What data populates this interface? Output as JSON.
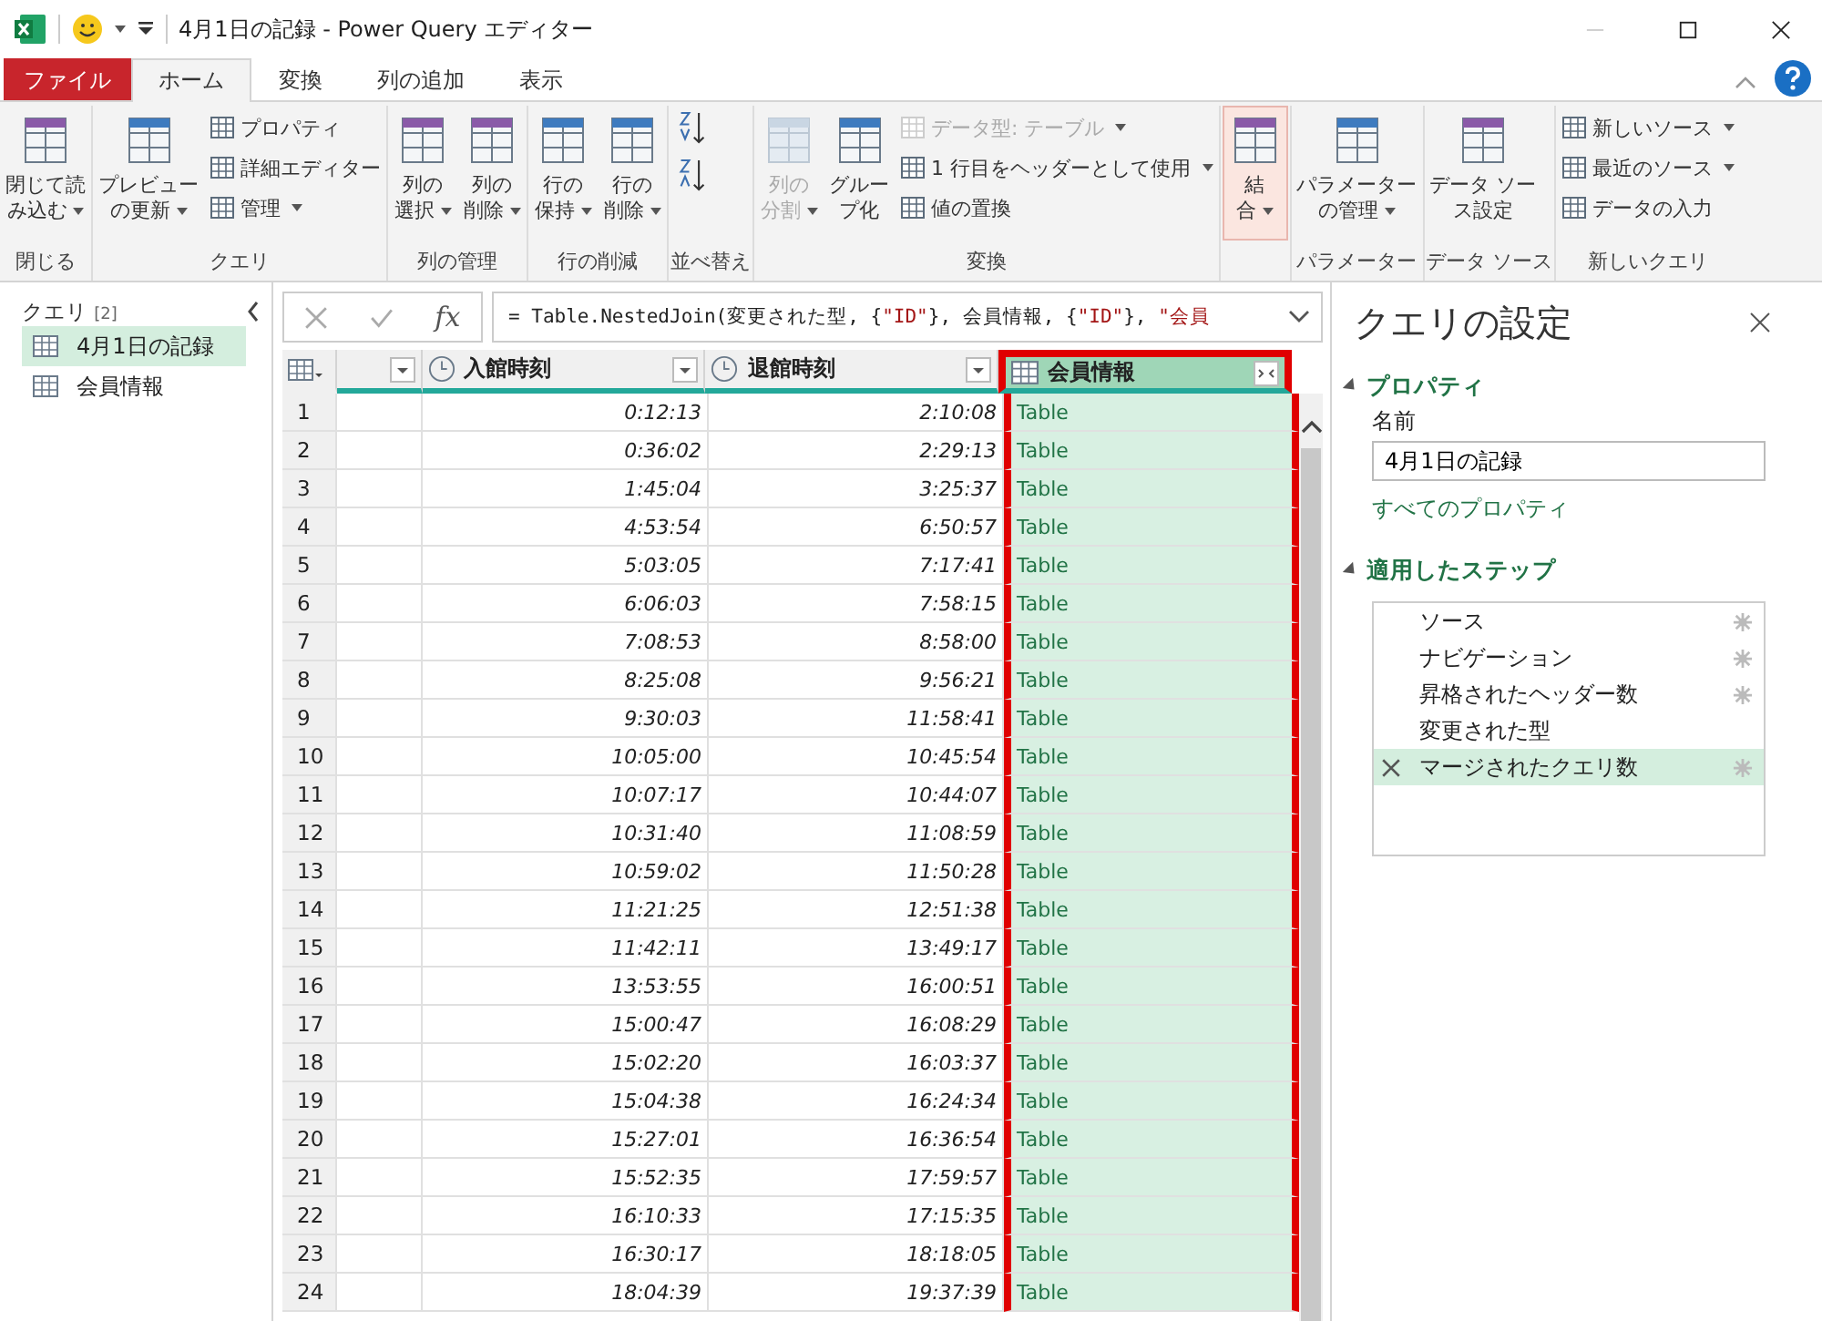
{
  "window": {
    "title": "4月1日の記録 - Power Query エディター"
  },
  "tabs": [
    {
      "label": "ファイル",
      "kind": "file",
      "selected": false
    },
    {
      "label": "ホーム",
      "kind": "tab",
      "selected": true
    },
    {
      "label": "変換",
      "kind": "tab",
      "selected": false
    },
    {
      "label": "列の追加",
      "kind": "tab",
      "selected": false
    },
    {
      "label": "表示",
      "kind": "tab",
      "selected": false
    }
  ],
  "ribbon": [
    {
      "label": "閉じる",
      "items": [
        {
          "kind": "large",
          "lines": [
            "閉じて読",
            "み込む"
          ],
          "dropdown": true,
          "disabled": false
        }
      ]
    },
    {
      "label": "クエリ",
      "items": [
        {
          "kind": "large",
          "lines": [
            "プレビュー",
            "の更新"
          ],
          "dropdown": true,
          "disabled": false
        },
        {
          "kind": "stack",
          "entries": [
            {
              "label": "プロパティ",
              "dropdown": false,
              "disabled": false
            },
            {
              "label": "詳細エディター",
              "dropdown": false,
              "disabled": false
            },
            {
              "label": "管理",
              "dropdown": true,
              "disabled": false
            }
          ]
        }
      ]
    },
    {
      "label": "列の管理",
      "items": [
        {
          "kind": "large",
          "lines": [
            "列の",
            "選択"
          ],
          "dropdown": true,
          "disabled": false
        },
        {
          "kind": "large",
          "lines": [
            "列の",
            "削除"
          ],
          "dropdown": true,
          "disabled": false
        }
      ]
    },
    {
      "label": "行の削減",
      "items": [
        {
          "kind": "large",
          "lines": [
            "行の",
            "保持"
          ],
          "dropdown": true,
          "disabled": false
        },
        {
          "kind": "large",
          "lines": [
            "行の",
            "削除"
          ],
          "dropdown": true,
          "disabled": false
        }
      ]
    },
    {
      "label": "並べ替え",
      "items": [
        {
          "kind": "sort"
        }
      ]
    },
    {
      "label": "変換",
      "items": [
        {
          "kind": "large",
          "lines": [
            "列の",
            "分割"
          ],
          "dropdown": true,
          "disabled": true
        },
        {
          "kind": "large",
          "lines": [
            "グルー",
            "プ化"
          ],
          "dropdown": false,
          "disabled": false
        },
        {
          "kind": "stack",
          "entries": [
            {
              "label": "データ型: テーブル",
              "dropdown": true,
              "disabled": true
            },
            {
              "label": "1 行目をヘッダーとして使用",
              "dropdown": true,
              "disabled": false
            },
            {
              "label": "値の置換",
              "dropdown": false,
              "disabled": false
            }
          ]
        }
      ]
    },
    {
      "items": [
        {
          "kind": "large",
          "lines": [
            "結",
            "合"
          ],
          "dropdown": true,
          "disabled": false,
          "selected": true
        }
      ]
    },
    {
      "label": "パラメーター",
      "items": [
        {
          "kind": "large",
          "lines": [
            "パラメーター",
            "の管理"
          ],
          "dropdown": true,
          "disabled": false
        }
      ]
    },
    {
      "label": "データ ソース",
      "items": [
        {
          "kind": "large",
          "lines": [
            "データ ソー",
            "ス設定"
          ],
          "dropdown": false,
          "disabled": false
        }
      ]
    },
    {
      "label": "新しいクエリ",
      "items": [
        {
          "kind": "stack",
          "entries": [
            {
              "label": "新しいソース",
              "dropdown": true,
              "disabled": false
            },
            {
              "label": "最近のソース",
              "dropdown": true,
              "disabled": false
            },
            {
              "label": "データの入力",
              "dropdown": false,
              "disabled": false
            }
          ]
        }
      ]
    }
  ],
  "queries": {
    "title": "クエリ",
    "count": "[2]",
    "items": [
      {
        "label": "4月1日の記録",
        "selected": true
      },
      {
        "label": "会員情報",
        "selected": false
      }
    ]
  },
  "formula_bar": {
    "fx": "fx",
    "tokens": [
      {
        "text": "= Table.NestedJoin(変更された型, {",
        "kind": "code"
      },
      {
        "text": "\"ID\"",
        "kind": "string"
      },
      {
        "text": "}, 会員情報, {",
        "kind": "code"
      },
      {
        "text": "\"ID\"",
        "kind": "string"
      },
      {
        "text": "}, ",
        "kind": "code"
      },
      {
        "text": "\"会員",
        "kind": "string"
      }
    ]
  },
  "table": {
    "columns": [
      {
        "kind": "none",
        "selected": false,
        "highlighted": false
      },
      {
        "label": "入館時刻",
        "kind": "time",
        "selected": false,
        "highlighted": false
      },
      {
        "label": "退館時刻",
        "kind": "time",
        "selected": false,
        "highlighted": false
      },
      {
        "label": "会員情報",
        "kind": "table",
        "selected": true,
        "highlighted": true
      }
    ],
    "rows": [
      {
        "number": "1",
        "entry": "0:12:13",
        "exit": "2:10:08",
        "member": "Table"
      },
      {
        "number": "2",
        "entry": "0:36:02",
        "exit": "2:29:13",
        "member": "Table"
      },
      {
        "number": "3",
        "entry": "1:45:04",
        "exit": "3:25:37",
        "member": "Table"
      },
      {
        "number": "4",
        "entry": "4:53:54",
        "exit": "6:50:57",
        "member": "Table"
      },
      {
        "number": "5",
        "entry": "5:03:05",
        "exit": "7:17:41",
        "member": "Table"
      },
      {
        "number": "6",
        "entry": "6:06:03",
        "exit": "7:58:15",
        "member": "Table"
      },
      {
        "number": "7",
        "entry": "7:08:53",
        "exit": "8:58:00",
        "member": "Table"
      },
      {
        "number": "8",
        "entry": "8:25:08",
        "exit": "9:56:21",
        "member": "Table"
      },
      {
        "number": "9",
        "entry": "9:30:03",
        "exit": "11:58:41",
        "member": "Table"
      },
      {
        "number": "10",
        "entry": "10:05:00",
        "exit": "10:45:54",
        "member": "Table"
      },
      {
        "number": "11",
        "entry": "10:07:17",
        "exit": "10:44:07",
        "member": "Table"
      },
      {
        "number": "12",
        "entry": "10:31:40",
        "exit": "11:08:59",
        "member": "Table"
      },
      {
        "number": "13",
        "entry": "10:59:02",
        "exit": "11:50:28",
        "member": "Table"
      },
      {
        "number": "14",
        "entry": "11:21:25",
        "exit": "12:51:38",
        "member": "Table"
      },
      {
        "number": "15",
        "entry": "11:42:11",
        "exit": "13:49:17",
        "member": "Table"
      },
      {
        "number": "16",
        "entry": "13:53:55",
        "exit": "16:00:51",
        "member": "Table"
      },
      {
        "number": "17",
        "entry": "15:00:47",
        "exit": "16:08:29",
        "member": "Table"
      },
      {
        "number": "18",
        "entry": "15:02:20",
        "exit": "16:03:37",
        "member": "Table"
      },
      {
        "number": "19",
        "entry": "15:04:38",
        "exit": "16:24:34",
        "member": "Table"
      },
      {
        "number": "20",
        "entry": "15:27:01",
        "exit": "16:36:54",
        "member": "Table"
      },
      {
        "number": "21",
        "entry": "15:52:35",
        "exit": "17:59:57",
        "member": "Table"
      },
      {
        "number": "22",
        "entry": "16:10:33",
        "exit": "17:15:35",
        "member": "Table"
      },
      {
        "number": "23",
        "entry": "16:30:17",
        "exit": "18:18:05",
        "member": "Table"
      },
      {
        "number": "24",
        "entry": "18:04:39",
        "exit": "19:37:39",
        "member": "Table"
      }
    ]
  },
  "settings": {
    "title": "クエリの設定",
    "properties": {
      "title": "プロパティ",
      "expanded": true,
      "name_label": "名前",
      "name_value": "4月1日の記録",
      "link": "すべてのプロパティ"
    },
    "steps": {
      "title": "適用したステップ",
      "expanded": true,
      "items": [
        {
          "label": "ソース",
          "has_settings": true,
          "selected": false
        },
        {
          "label": "ナビゲーション",
          "has_settings": true,
          "selected": false
        },
        {
          "label": "昇格されたヘッダー数",
          "has_settings": true,
          "selected": false
        },
        {
          "label": "変更された型",
          "has_settings": false,
          "selected": false
        },
        {
          "label": "マージされたクエリ数",
          "has_settings": true,
          "selected": true
        }
      ]
    }
  }
}
